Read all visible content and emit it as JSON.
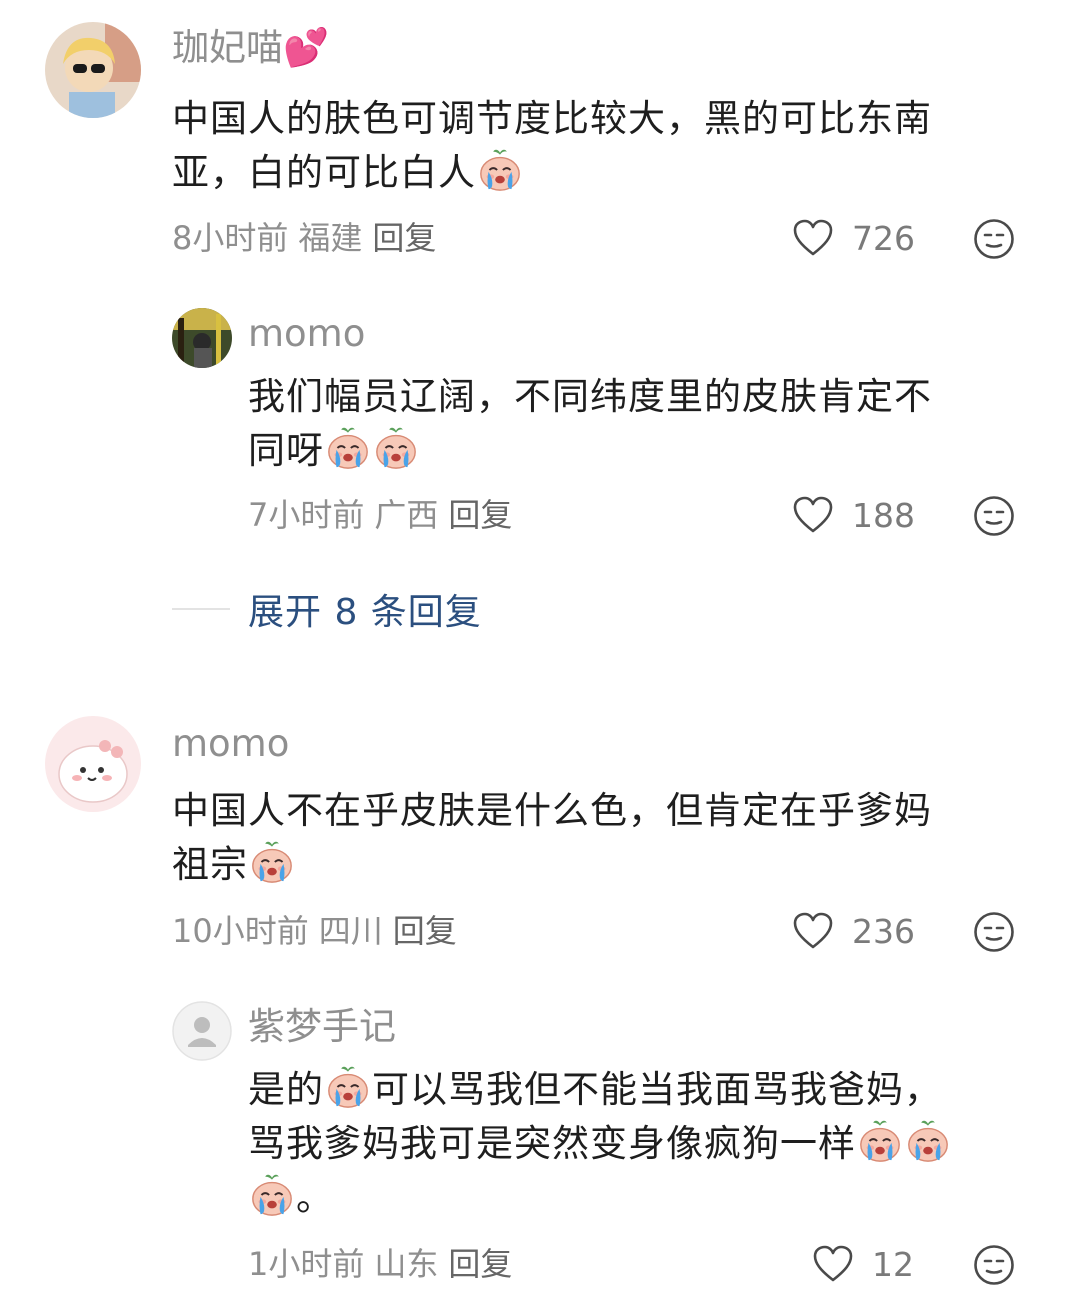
{
  "comments": [
    {
      "user": "珈妃喵",
      "user_emoji": "💕",
      "text_lines": [
        "中国人的肤色可调节度比较大，黑的可比东南",
        "亚，白的可比白人"
      ],
      "time": "8小时前",
      "location": "福建",
      "reply_label": "回复",
      "likes": "726"
    },
    {
      "user": "momo",
      "text_lines": [
        "我们幅员辽阔，不同纬度里的皮肤肯定不",
        "同呀"
      ],
      "time": "7小时前",
      "location": "广西",
      "reply_label": "回复",
      "likes": "188"
    },
    {
      "user": "momo",
      "text_lines": [
        "中国人不在乎皮肤是什么色，但肯定在乎爹妈",
        "祖宗"
      ],
      "time": "10小时前",
      "location": "四川",
      "reply_label": "回复",
      "likes": "236"
    },
    {
      "user": "紫梦手记",
      "text_lines": [
        "是的",
        "可以骂我但不能当我面骂我爸妈，",
        "骂我爹妈我可是突然变身像疯狗一样",
        "。"
      ],
      "time": "1小时前",
      "location": "山东",
      "reply_label": "回复",
      "likes": "12"
    }
  ],
  "expand_replies": "展开 8 条回复",
  "icons": {
    "like": "heart-outline-icon",
    "dislike": "meh-face-icon",
    "emoji": "crying-face-emoji"
  },
  "colors": {
    "username": "#8f8f8f",
    "text": "#1e1e1e",
    "expand_link": "#2b4f7f"
  }
}
